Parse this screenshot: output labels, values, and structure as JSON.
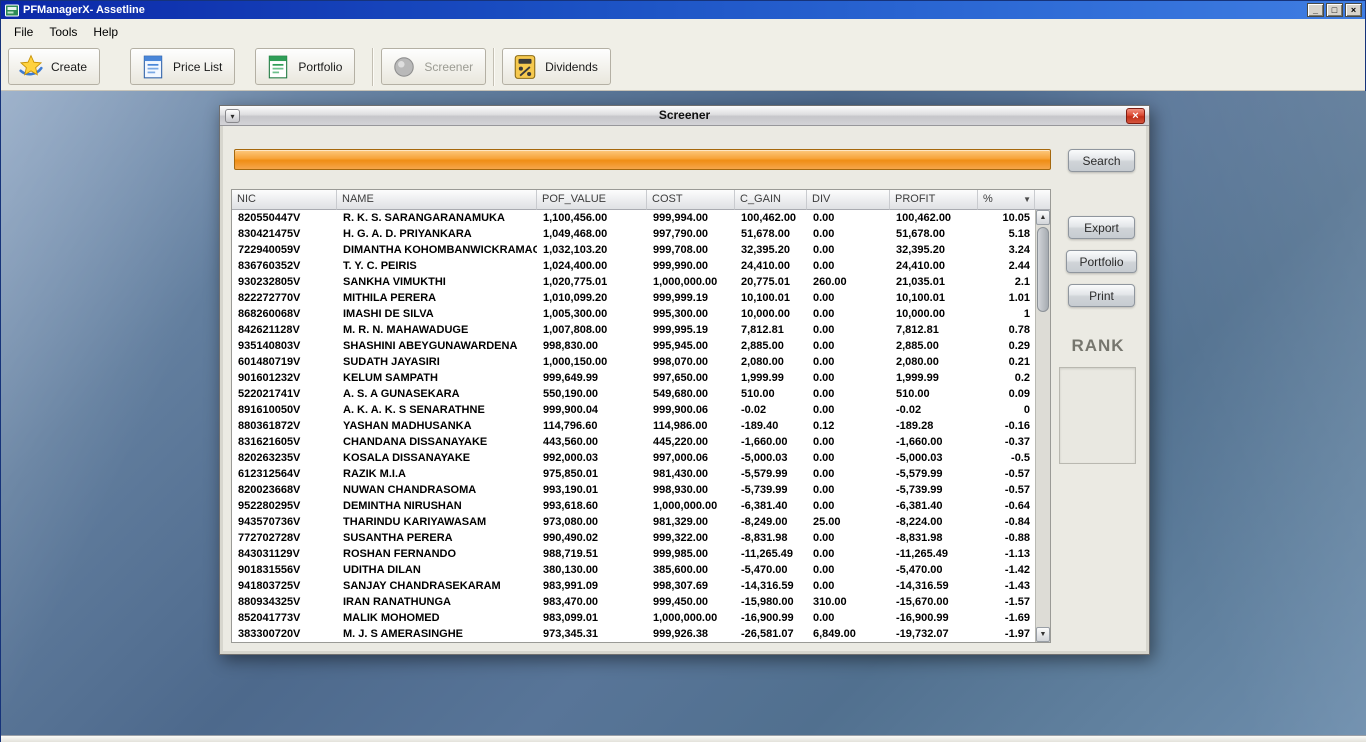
{
  "window": {
    "title": "PFManagerX- Assetline",
    "minimize_glyph": "_",
    "maximize_glyph": "□",
    "close_glyph": "×"
  },
  "menubar": {
    "items": [
      "File",
      "Tools",
      "Help"
    ]
  },
  "toolbar": {
    "buttons": [
      {
        "label": "Create",
        "icon": "create-star-icon",
        "enabled": true
      },
      {
        "label": "Price List",
        "icon": "price-list-icon",
        "enabled": true
      },
      {
        "label": "Portfolio",
        "icon": "portfolio-icon",
        "enabled": true
      },
      {
        "label": "Screener",
        "icon": "screener-icon",
        "enabled": false
      },
      {
        "label": "Dividends",
        "icon": "dividends-icon",
        "enabled": true
      }
    ]
  },
  "icons": {
    "scroll_up": "▲",
    "scroll_down": "▼",
    "sort_desc": "▼",
    "frame_menu": "▾"
  },
  "colors": {
    "progress_orange": "#EF8D14",
    "close_button_red": "#C93A24",
    "titlebar_blue": "#1A4FC2"
  },
  "screener": {
    "title": "Screener",
    "close_glyph": "×",
    "search_button": "Search",
    "export_button": "Export",
    "portfolio_button": "Portfolio",
    "print_button": "Print",
    "rank_label": "RANK",
    "table": {
      "columns": [
        "NIC",
        "NAME",
        "POF_VALUE",
        "COST",
        "C_GAIN",
        "DIV",
        "PROFIT",
        "%"
      ],
      "sort_column": "%",
      "sort_direction": "desc",
      "rows": [
        [
          "820550447V",
          "R. K. S. SARANGARANAMUKA",
          "1,100,456.00",
          "999,994.00",
          "100,462.00",
          "0.00",
          "100,462.00",
          "10.05"
        ],
        [
          "830421475V",
          "H. G. A. D. PRIYANKARA",
          "1,049,468.00",
          "997,790.00",
          "51,678.00",
          "0.00",
          "51,678.00",
          "5.18"
        ],
        [
          "722940059V",
          "DIMANTHA KOHOMBANWICKRAMAGE",
          "1,032,103.20",
          "999,708.00",
          "32,395.20",
          "0.00",
          "32,395.20",
          "3.24"
        ],
        [
          "836760352V",
          "T. Y. C. PEIRIS",
          "1,024,400.00",
          "999,990.00",
          "24,410.00",
          "0.00",
          "24,410.00",
          "2.44"
        ],
        [
          "930232805V",
          "SANKHA VIMUKTHI",
          "1,020,775.01",
          "1,000,000.00",
          "20,775.01",
          "260.00",
          "21,035.01",
          "2.1"
        ],
        [
          "822272770V",
          "MITHILA PERERA",
          "1,010,099.20",
          "999,999.19",
          "10,100.01",
          "0.00",
          "10,100.01",
          "1.01"
        ],
        [
          "868260068V",
          "IMASHI DE SILVA",
          "1,005,300.00",
          "995,300.00",
          "10,000.00",
          "0.00",
          "10,000.00",
          "1"
        ],
        [
          "842621128V",
          "M. R. N. MAHAWADUGE",
          "1,007,808.00",
          "999,995.19",
          "7,812.81",
          "0.00",
          "7,812.81",
          "0.78"
        ],
        [
          "935140803V",
          "SHASHINI ABEYGUNAWARDENA",
          "998,830.00",
          "995,945.00",
          "2,885.00",
          "0.00",
          "2,885.00",
          "0.29"
        ],
        [
          "601480719V",
          "SUDATH JAYASIRI",
          "1,000,150.00",
          "998,070.00",
          "2,080.00",
          "0.00",
          "2,080.00",
          "0.21"
        ],
        [
          "901601232V",
          "KELUM SAMPATH",
          "999,649.99",
          "997,650.00",
          "1,999.99",
          "0.00",
          "1,999.99",
          "0.2"
        ],
        [
          "522021741V",
          "A. S. A GUNASEKARA",
          "550,190.00",
          "549,680.00",
          "510.00",
          "0.00",
          "510.00",
          "0.09"
        ],
        [
          "891610050V",
          "A. K. A. K. S SENARATHNE",
          "999,900.04",
          "999,900.06",
          "-0.02",
          "0.00",
          "-0.02",
          "0"
        ],
        [
          "880361872V",
          "YASHAN MADHUSANKA",
          "114,796.60",
          "114,986.00",
          "-189.40",
          "0.12",
          "-189.28",
          "-0.16"
        ],
        [
          "831621605V",
          "CHANDANA DISSANAYAKE",
          "443,560.00",
          "445,220.00",
          "-1,660.00",
          "0.00",
          "-1,660.00",
          "-0.37"
        ],
        [
          "820263235V",
          "KOSALA DISSANAYAKE",
          "992,000.03",
          "997,000.06",
          "-5,000.03",
          "0.00",
          "-5,000.03",
          "-0.5"
        ],
        [
          "612312564V",
          "RAZIK M.I.A",
          "975,850.01",
          "981,430.00",
          "-5,579.99",
          "0.00",
          "-5,579.99",
          "-0.57"
        ],
        [
          "820023668V",
          "NUWAN CHANDRASOMA",
          "993,190.01",
          "998,930.00",
          "-5,739.99",
          "0.00",
          "-5,739.99",
          "-0.57"
        ],
        [
          "952280295V",
          "DEMINTHA NIRUSHAN",
          "993,618.60",
          "1,000,000.00",
          "-6,381.40",
          "0.00",
          "-6,381.40",
          "-0.64"
        ],
        [
          "943570736V",
          "THARINDU KARIYAWASAM",
          "973,080.00",
          "981,329.00",
          "-8,249.00",
          "25.00",
          "-8,224.00",
          "-0.84"
        ],
        [
          "772702728V",
          "SUSANTHA PERERA",
          "990,490.02",
          "999,322.00",
          "-8,831.98",
          "0.00",
          "-8,831.98",
          "-0.88"
        ],
        [
          "843031129V",
          "ROSHAN FERNANDO",
          "988,719.51",
          "999,985.00",
          "-11,265.49",
          "0.00",
          "-11,265.49",
          "-1.13"
        ],
        [
          "901831556V",
          "UDITHA DILAN",
          "380,130.00",
          "385,600.00",
          "-5,470.00",
          "0.00",
          "-5,470.00",
          "-1.42"
        ],
        [
          "941803725V",
          "SANJAY CHANDRASEKARAM",
          "983,991.09",
          "998,307.69",
          "-14,316.59",
          "0.00",
          "-14,316.59",
          "-1.43"
        ],
        [
          "880934325V",
          "IRAN RANATHUNGA",
          "983,470.00",
          "999,450.00",
          "-15,980.00",
          "310.00",
          "-15,670.00",
          "-1.57"
        ],
        [
          "852041773V",
          "MALIK MOHOMED",
          "983,099.01",
          "1,000,000.00",
          "-16,900.99",
          "0.00",
          "-16,900.99",
          "-1.69"
        ],
        [
          "383300720V",
          "M. J. S AMERASINGHE",
          "973,345.31",
          "999,926.38",
          "-26,581.07",
          "6,849.00",
          "-19,732.07",
          "-1.97"
        ]
      ]
    }
  }
}
